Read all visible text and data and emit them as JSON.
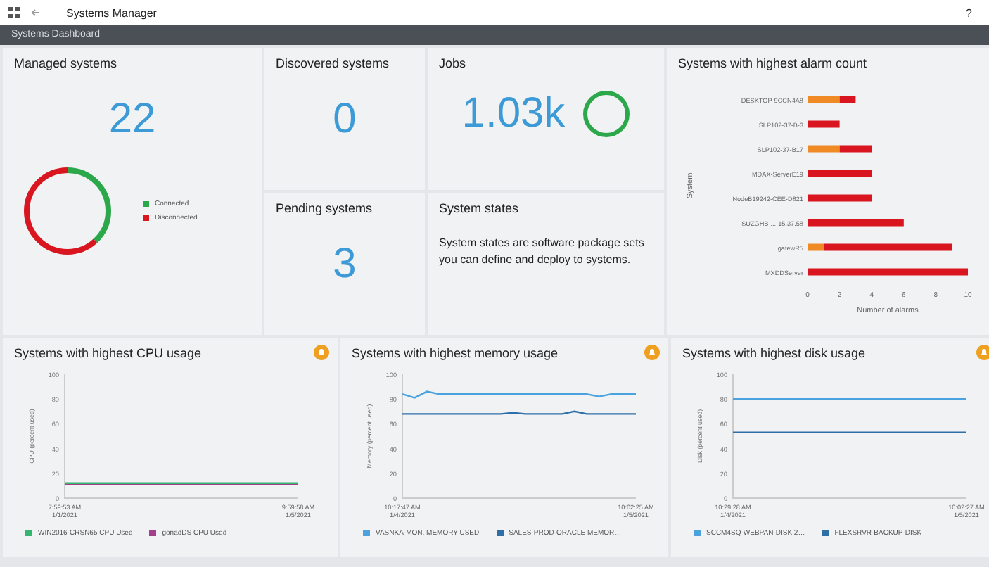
{
  "title_bar": {
    "title": "Systems Manager",
    "help": "?"
  },
  "breadcrumb": "Systems Dashboard",
  "managed": {
    "title": "Managed systems",
    "count": "22",
    "legend": [
      {
        "label": "Connected",
        "color": "#2ba84a"
      },
      {
        "label": "Disconnected",
        "color": "#d9151f"
      }
    ]
  },
  "discovered": {
    "title": "Discovered systems",
    "count": "0"
  },
  "jobs": {
    "title": "Jobs",
    "count": "1.03k"
  },
  "pending": {
    "title": "Pending systems",
    "count": "3"
  },
  "system_states": {
    "title": "System states",
    "text": "System states are software package sets you can define and deploy to systems."
  },
  "alarms": {
    "title": "Systems with highest alarm count",
    "chart_data": {
      "type": "bar",
      "orientation": "horizontal",
      "stacked": true,
      "xlabel": "Number of alarms",
      "ylabel": "System",
      "categories": [
        "DESKTOP-9CCN4A8",
        "SLP102-37-B-3",
        "SLP102-37-B17",
        "MDAX-ServerE19",
        "NodeB19242-CEE-D821",
        "SUZGHB-...-15.37.58",
        "gatewR5",
        "MXDDServer"
      ],
      "series": [
        {
          "color": "#f08a24",
          "values": [
            2,
            0,
            2,
            0,
            0,
            0,
            1,
            0
          ]
        },
        {
          "color": "#d9151f",
          "values": [
            1,
            2,
            2,
            4,
            4,
            6,
            8,
            10
          ]
        }
      ],
      "xlim": [
        0,
        10
      ],
      "xticks": [
        0,
        2,
        4,
        6,
        8,
        10
      ]
    }
  },
  "usage_charts": [
    {
      "title": "Systems with highest CPU usage",
      "chart_data": {
        "type": "line",
        "ylabel": "CPU (percent used)",
        "ylim": [
          0,
          100
        ],
        "yticks": [
          0,
          20,
          40,
          60,
          80,
          100
        ],
        "categories": [
          "7:59:53 AM 1/1/2021",
          null,
          null,
          null,
          null,
          null,
          null,
          null,
          null,
          null,
          null,
          null,
          null,
          null,
          null,
          null,
          null,
          null,
          null,
          "9:59:58 AM 1/5/2021"
        ],
        "series": [
          {
            "name": "WIN2016-CRSN65 CPU Used",
            "color": "#35b56f",
            "values": [
              12,
              12,
              12,
              12,
              12,
              12,
              12,
              12,
              12,
              12,
              12,
              12,
              12,
              12,
              12,
              12,
              12,
              12,
              12,
              12
            ]
          },
          {
            "name": "gonadDS CPU Used",
            "color": "#a43f8c",
            "values": [
              11,
              11,
              11,
              11,
              11,
              11,
              11,
              11,
              11,
              11,
              11,
              11,
              11,
              11,
              11,
              11,
              11,
              11,
              11,
              11
            ]
          }
        ]
      }
    },
    {
      "title": "Systems with highest memory usage",
      "chart_data": {
        "type": "line",
        "ylabel": "Memory (percent used)",
        "ylim": [
          0,
          100
        ],
        "yticks": [
          0,
          20,
          40,
          60,
          80,
          100
        ],
        "categories": [
          "10:17:47 AM 1/4/2021",
          null,
          null,
          null,
          null,
          null,
          null,
          null,
          null,
          null,
          null,
          null,
          null,
          null,
          null,
          null,
          null,
          null,
          null,
          "10:02:25 AM 1/5/2021"
        ],
        "series": [
          {
            "name": "VASNKA-MON. MEMORY USED",
            "color": "#4aa3df",
            "values": [
              84,
              81,
              86,
              84,
              84,
              84,
              84,
              84,
              84,
              84,
              84,
              84,
              84,
              84,
              84,
              84,
              82,
              84,
              84,
              84
            ]
          },
          {
            "name": "SALES-PROD-ORACLE MEMOR…",
            "color": "#2f6fa8",
            "values": [
              68,
              68,
              68,
              68,
              68,
              68,
              68,
              68,
              68,
              69,
              68,
              68,
              68,
              68,
              70,
              68,
              68,
              68,
              68,
              68
            ]
          }
        ]
      }
    },
    {
      "title": "Systems with highest disk usage",
      "chart_data": {
        "type": "line",
        "ylabel": "Disk (percent used)",
        "ylim": [
          0,
          100
        ],
        "yticks": [
          0,
          20,
          40,
          60,
          80,
          100
        ],
        "categories": [
          "10:29:28 AM 1/4/2021",
          null,
          null,
          null,
          null,
          null,
          null,
          null,
          null,
          null,
          null,
          null,
          null,
          null,
          null,
          null,
          null,
          null,
          null,
          "10:02:27 AM 1/5/2021"
        ],
        "series": [
          {
            "name": "SCCM4SQ-WEBPAN-DISK 2…",
            "color": "#4aa3df",
            "values": [
              80,
              80,
              80,
              80,
              80,
              80,
              80,
              80,
              80,
              80,
              80,
              80,
              80,
              80,
              80,
              80,
              80,
              80,
              80,
              80
            ]
          },
          {
            "name": "FLEXSRVR-BACKUP-DISK",
            "color": "#2f6fa8",
            "values": [
              53,
              53,
              53,
              53,
              53,
              53,
              53,
              53,
              53,
              53,
              53,
              53,
              53,
              53,
              53,
              53,
              53,
              53,
              53,
              53
            ]
          }
        ]
      }
    }
  ]
}
